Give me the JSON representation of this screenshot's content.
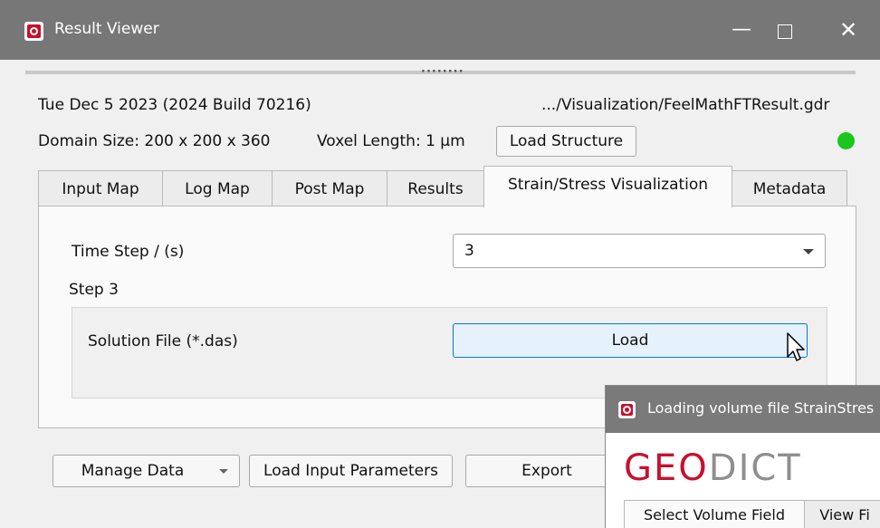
{
  "window": {
    "title": "Result Viewer",
    "minimize_label": "—",
    "close_label": "✕"
  },
  "header": {
    "build_info": "Tue Dec 5 2023 (2024 Build 70216)",
    "file_path": ".../Visualization/FeelMathFTResult.gdr",
    "domain_size": "Domain Size: 200 x 200 x 360",
    "voxel_length": "Voxel Length: 1 µm",
    "load_structure_label": "Load Structure",
    "status_color": "#1bc71b"
  },
  "tabs": [
    {
      "label": "Input Map"
    },
    {
      "label": "Log Map"
    },
    {
      "label": "Post Map"
    },
    {
      "label": "Results"
    },
    {
      "label": "Strain/Stress Visualization",
      "active": true
    },
    {
      "label": "Metadata"
    }
  ],
  "panel": {
    "time_step_label": "Time Step / (s)",
    "time_step_value": "3",
    "step_label": "Step 3",
    "solution_file_label": "Solution File (*.das)",
    "load_label": "Load"
  },
  "bottom": {
    "manage_data_label": "Manage Data",
    "load_input_params_label": "Load Input Parameters",
    "export_label": "Export"
  },
  "overlay": {
    "title": "Loading volume file StrainStres",
    "logo_part1": "GEO",
    "logo_part2": "DICT",
    "tab_select": "Select Volume Field",
    "tab_view": "View Fi"
  },
  "colors": {
    "brand_red": "#c8102e",
    "accent_blue": "#0078d7"
  }
}
